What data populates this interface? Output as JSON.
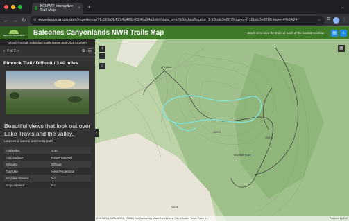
{
  "browser": {
    "tab_title": "BCNWR Interactive Trail Map",
    "url_domain": "experience.arcgis.com",
    "url_path": "/experience/7fc243a2b1234b428cf6246a34a3eb/#data_s=id%3AdataSource_1-18bdc3e8575-layer-2-18bdc3e8785-layer-4%3A24"
  },
  "app": {
    "title": "Balcones Canyonlands NWR Trails Map",
    "hint": "Zoom in to view the trails at each of the locations below",
    "logo_text": "Balcones Canyonlands"
  },
  "panel": {
    "scroll_hint": "Scroll Through Individual Trails Below and Click to Zoom",
    "pager": "4 of 7",
    "trail_title": "Rimrock Trail / Difficult / 3.40 miles",
    "description": "Beautiful views that look out over Lake Travis and the valley.",
    "subtitle": "Loop on a natural and rocky path",
    "attributes": [
      {
        "label": "Trail Miles",
        "value": "3.40"
      },
      {
        "label": "Trail Surface",
        "value": "Native Material"
      },
      {
        "label": "Difficulty",
        "value": "Difficult"
      },
      {
        "label": "Trail Use",
        "value": "Hiker/Pedestrian"
      },
      {
        "label": "Bicycles Allowed",
        "value": "No"
      },
      {
        "label": "Dogs Allowed",
        "value": "No"
      }
    ]
  },
  "map": {
    "attribution": "Esri, NASA, NGA, USGS, FEMA | Esri Community Maps Contributors, City of Austin, Texas Parks & ...",
    "powered": "Powered by Esri",
    "labels": [
      "Pavilion",
      "1020 ft",
      "1000 ft",
      "940 ft",
      "Mountain Road"
    ]
  }
}
